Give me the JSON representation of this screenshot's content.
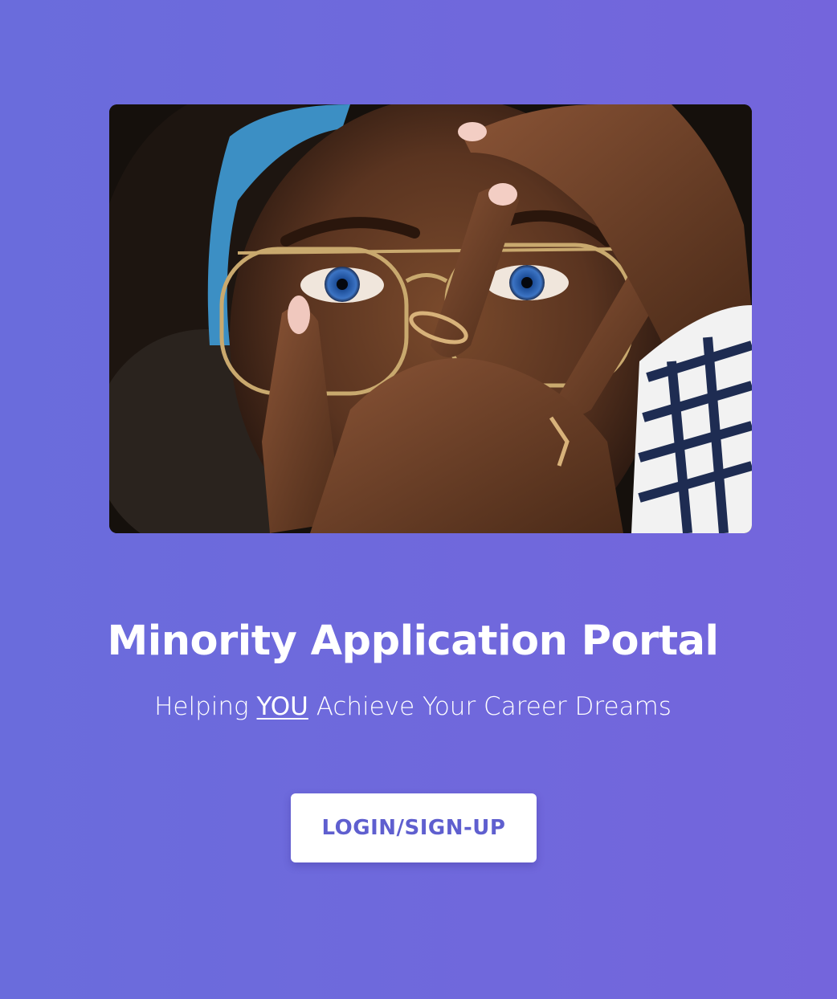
{
  "hero": {
    "image_alt": "Portrait of a woman with blue eyes wearing glasses, hands with rings framing her face"
  },
  "header": {
    "title": "Minority Application Portal"
  },
  "tagline": {
    "before": "Helping ",
    "emphasis": "YOU",
    "after": " Achieve Your Career Dreams"
  },
  "actions": {
    "login_label": "LOGIN/SIGN-UP"
  },
  "colors": {
    "background": "#6c6adc",
    "button_text": "#5f5fcf",
    "text": "#ffffff"
  }
}
